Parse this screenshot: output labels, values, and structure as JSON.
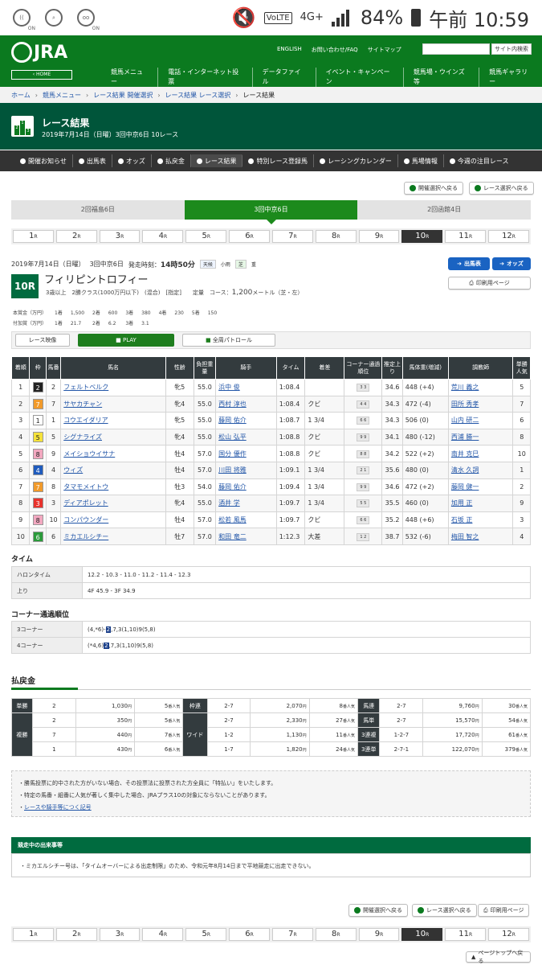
{
  "status": {
    "battery": "84%",
    "time": "午前 10:59",
    "net": "4G+",
    "lte": "VoLTE",
    "on1": "ON",
    "on2": "ON"
  },
  "header": {
    "logo": "JRA",
    "home": "‹ HOME",
    "links": [
      "ENGLISH",
      "お問い合わせ/FAQ",
      "サイトマップ"
    ],
    "search_button": "サイト内検索",
    "menu": [
      "競馬メニュー",
      "電話・インターネット投票",
      "データファイル",
      "イベント・キャンペーン",
      "競馬場・ウインズ等",
      "競馬ギャラリー"
    ]
  },
  "breadcrumb": [
    "ホーム",
    "競馬メニュー",
    "レース結果 開催選択",
    "レース結果 レース選択",
    "レース結果"
  ],
  "title": {
    "main": "レース結果",
    "sub": "2019年7月14日（日曜）3回中京6日 10レース",
    "icon": [
      "2",
      "1",
      "3"
    ]
  },
  "subnav": [
    "開催お知らせ",
    "出馬表",
    "オッズ",
    "払戻金",
    "レース結果",
    "特別レース登録馬",
    "レーシングカレンダー",
    "馬場情報",
    "今週の注目レース"
  ],
  "top_buttons": [
    "開催選択へ戻る",
    "レース選択へ戻る"
  ],
  "venues": [
    "2回福島6日",
    "3回中京6日",
    "2回函館4日"
  ],
  "races": [
    "1",
    "2",
    "3",
    "4",
    "5",
    "6",
    "7",
    "8",
    "9",
    "10",
    "11",
    "12"
  ],
  "race_suffix": "R",
  "race": {
    "date": "2019年7月14日（日曜）",
    "meeting": "3回中京6日",
    "start": "発走時刻：",
    "start_time": "14時50分",
    "weather_label": "天候",
    "weather": "小雨",
    "track_label": "芝",
    "track": "重",
    "number": "10R",
    "name": "フィリピントロフィー",
    "conditions": "3歳以上　2勝クラス(1000万円以下)　(混合)　[指定]　　定量",
    "course_label": "コース：",
    "course_dist": "1,200",
    "course_unit": "メートル（芝・左）",
    "btn_card": "出馬表",
    "btn_odds": "オッズ",
    "btn_print": "印刷用ページ"
  },
  "prize": {
    "label1": "本賞金（万円）",
    "label2": "付加賞（万円）",
    "row1": [
      "1着",
      "1,500",
      "2着",
      "600",
      "3着",
      "380",
      "4着",
      "230",
      "5着",
      "150"
    ],
    "row2": [
      "1着",
      "21.7",
      "2着",
      "6.2",
      "3着",
      "3.1"
    ]
  },
  "video": {
    "label": "レース映像",
    "play": "PLAY",
    "patrol": "全周パトロール"
  },
  "result_headers": [
    "着順",
    "枠",
    "馬番",
    "馬名",
    "性齢",
    "負担重量",
    "騎手",
    "タイム",
    "着差",
    "コーナー通過順位",
    "推定上り",
    "馬体重(増減)",
    "調教師",
    "単勝人気"
  ],
  "results": [
    {
      "pos": "1",
      "waku": "2",
      "num": "2",
      "horse": "フェルトベルク",
      "sex": "牝5",
      "wt": "55.0",
      "jockey": "浜中 俊",
      "time": "1:08.4",
      "margin": "",
      "corner": "3 3",
      "agari": "34.6",
      "body": "448 (+4)",
      "trainer": "荒川 義之",
      "pop": "5"
    },
    {
      "pos": "2",
      "waku": "7",
      "num": "7",
      "horse": "サヤカチャン",
      "sex": "牝4",
      "wt": "55.0",
      "jockey": "西村 淳也",
      "time": "1:08.4",
      "margin": "クビ",
      "corner": "4 4",
      "agari": "34.3",
      "body": "472 (-4)",
      "trainer": "田所 秀孝",
      "pop": "7"
    },
    {
      "pos": "3",
      "waku": "1",
      "num": "1",
      "horse": "コウエイダリア",
      "sex": "牝5",
      "wt": "55.0",
      "jockey": "藤岡 佑介",
      "time": "1:08.7",
      "margin": "1 3/4",
      "corner": "6 6",
      "agari": "34.3",
      "body": "506 (0)",
      "trainer": "山内 研二",
      "pop": "6"
    },
    {
      "pos": "4",
      "waku": "5",
      "num": "5",
      "horse": "シグナライズ",
      "sex": "牝4",
      "wt": "55.0",
      "jockey": "松山 弘平",
      "time": "1:08.8",
      "margin": "クビ",
      "corner": "9 9",
      "agari": "34.1",
      "body": "480 (-12)",
      "trainer": "西浦 勝一",
      "pop": "8"
    },
    {
      "pos": "5",
      "waku": "8",
      "num": "9",
      "horse": "メイショウイサナ",
      "sex": "牡4",
      "wt": "57.0",
      "jockey": "国分 優作",
      "time": "1:08.8",
      "margin": "クビ",
      "corner": "8 8",
      "agari": "34.2",
      "body": "522 (+2)",
      "trainer": "南井 克巳",
      "pop": "10"
    },
    {
      "pos": "6",
      "waku": "4",
      "num": "4",
      "horse": "ウィズ",
      "sex": "牡4",
      "wt": "57.0",
      "jockey": "川田 将雅",
      "time": "1:09.1",
      "margin": "1 3/4",
      "corner": "2 1",
      "agari": "35.6",
      "body": "480 (0)",
      "trainer": "清水 久詞",
      "pop": "1"
    },
    {
      "pos": "7",
      "waku": "7",
      "num": "8",
      "horse": "タマモメイトウ",
      "sex": "牡3",
      "wt": "54.0",
      "jockey": "藤岡 佑介",
      "time": "1:09.4",
      "margin": "1 3/4",
      "corner": "9 9",
      "agari": "34.6",
      "body": "472 (+2)",
      "trainer": "藤岡 健一",
      "pop": "2"
    },
    {
      "pos": "8",
      "waku": "3",
      "num": "3",
      "horse": "ディアポレット",
      "sex": "牝4",
      "wt": "55.0",
      "jockey": "酒井 学",
      "time": "1:09.7",
      "margin": "1 3/4",
      "corner": "5 5",
      "agari": "35.5",
      "body": "460 (0)",
      "trainer": "加用 正",
      "pop": "9"
    },
    {
      "pos": "9",
      "waku": "8",
      "num": "10",
      "horse": "コンパウンダー",
      "sex": "牡4",
      "wt": "57.0",
      "jockey": "松若 風馬",
      "time": "1:09.7",
      "margin": "クビ",
      "corner": "6 6",
      "agari": "35.2",
      "body": "448 (+6)",
      "trainer": "石坂 正",
      "pop": "3"
    },
    {
      "pos": "10",
      "waku": "6",
      "num": "6",
      "horse": "ミカエルシチー",
      "sex": "牡7",
      "wt": "57.0",
      "jockey": "和田 竜二",
      "time": "1:12.3",
      "margin": "大差",
      "corner": "1 2",
      "agari": "38.7",
      "body": "532 (-6)",
      "trainer": "梅田 智之",
      "pop": "4"
    }
  ],
  "waku_colors": {
    "1": "#ffffff",
    "2": "#222222",
    "3": "#e8322c",
    "4": "#1f5bbd",
    "5": "#f5e23a",
    "6": "#2a9a3a",
    "7": "#f19a2a",
    "8": "#f2a8c0"
  },
  "times": {
    "title": "タイム",
    "furlong_label": "ハロンタイム",
    "furlong": "12.2 - 10.3 - 11.0 - 11.2 - 11.4 - 12.3",
    "up_label": "上り",
    "up": "4F 45.9 - 3F 34.9"
  },
  "corners": {
    "title": "コーナー通過順位",
    "c3_label": "3コーナー",
    "c3_pre": "(4,*6)-",
    "c3_hl": "2",
    "c3_post": ",7,3(1,10)9(5,8)",
    "c4_label": "4コーナー",
    "c4_pre": "(*4,6)",
    "c4_hl": "2",
    "c4_post": ",7,3(1,10)9(5,8)"
  },
  "payout": {
    "title": "払戻金",
    "yen": "円",
    "pop": "番人気",
    "tansho": {
      "label": "単勝",
      "rows": [
        [
          "2",
          "1,030",
          "5"
        ]
      ]
    },
    "fukusho": {
      "label": "複勝",
      "rows": [
        [
          "2",
          "350",
          "5"
        ],
        [
          "7",
          "440",
          "7"
        ],
        [
          "1",
          "430",
          "6"
        ]
      ]
    },
    "wakuren": {
      "label": "枠連",
      "rows": [
        [
          "2-7",
          "2,070",
          "8"
        ]
      ]
    },
    "wide": {
      "label": "ワイド",
      "rows": [
        [
          "2-7",
          "2,330",
          "27"
        ],
        [
          "1-2",
          "1,130",
          "11"
        ],
        [
          "1-7",
          "1,820",
          "24"
        ]
      ]
    },
    "umaren": {
      "label": "馬連",
      "rows": [
        [
          "2-7",
          "9,760",
          "30"
        ]
      ]
    },
    "umatan": {
      "label": "馬単",
      "rows": [
        [
          "2-7",
          "15,570",
          "54"
        ]
      ]
    },
    "trio": {
      "label": "3連複",
      "rows": [
        [
          "1-2-7",
          "17,720",
          "61"
        ]
      ]
    },
    "trifecta": {
      "label": "3連単",
      "rows": [
        [
          "2-7-1",
          "122,070",
          "379"
        ]
      ]
    }
  },
  "notes": [
    "勝馬投票に的中された方がいない場合、その投票法に投票された方全員に「特払い」をいたします。",
    "特定の馬番・組番に人気が著しく集中した場合、JRAプラス10の対象にならないことがあります。",
    "レースや騎手等につく記号"
  ],
  "events": {
    "title": "競走中の出来事等",
    "text": "ミカエルシチー号は、「タイムオーバーによる出走制限」のため、令和元年8月14日まで平地競走に出走できない。"
  },
  "bottom_buttons": [
    "開催選択へ戻る",
    "レース選択へ戻る",
    "印刷用ページ"
  ],
  "page_top": "ページトップへ戻る"
}
